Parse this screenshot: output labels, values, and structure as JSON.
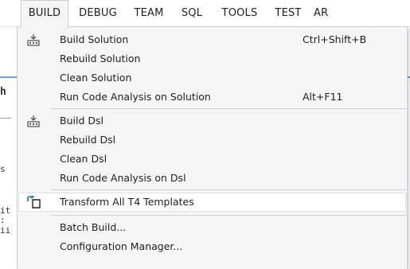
{
  "menubar": {
    "items": [
      {
        "label": "BUILD",
        "active": true
      },
      {
        "label": "DEBUG"
      },
      {
        "label": "TEAM"
      },
      {
        "label": "SQL"
      },
      {
        "label": "TOOLS"
      },
      {
        "label": "TEST"
      },
      {
        "label": "AR"
      }
    ]
  },
  "background": {
    "fragments": [
      "h",
      "s",
      "it",
      ":",
      "ii"
    ]
  },
  "build_menu": {
    "items": [
      {
        "label": "Build Solution",
        "shortcut": "Ctrl+Shift+B",
        "icon": "build-icon"
      },
      {
        "label": "Rebuild Solution"
      },
      {
        "label": "Clean Solution"
      },
      {
        "label": "Run Code Analysis on Solution",
        "shortcut": "Alt+F11"
      },
      {
        "label": "Build Dsl",
        "icon": "build-icon"
      },
      {
        "label": "Rebuild Dsl"
      },
      {
        "label": "Clean Dsl"
      },
      {
        "label": "Run Code Analysis on Dsl"
      },
      {
        "label": "Transform All T4 Templates",
        "icon": "transform-templates-icon",
        "highlighted": true
      },
      {
        "label": "Batch Build..."
      },
      {
        "label": "Configuration Manager..."
      }
    ]
  },
  "colors": {
    "menu_background": "#f5f5f5",
    "menu_border": "#cccedb",
    "highlight": "#ffffff",
    "icon_gray": "#5a5a5a",
    "icon_blue": "#2a7bc7",
    "text": "#1e1e1e"
  }
}
